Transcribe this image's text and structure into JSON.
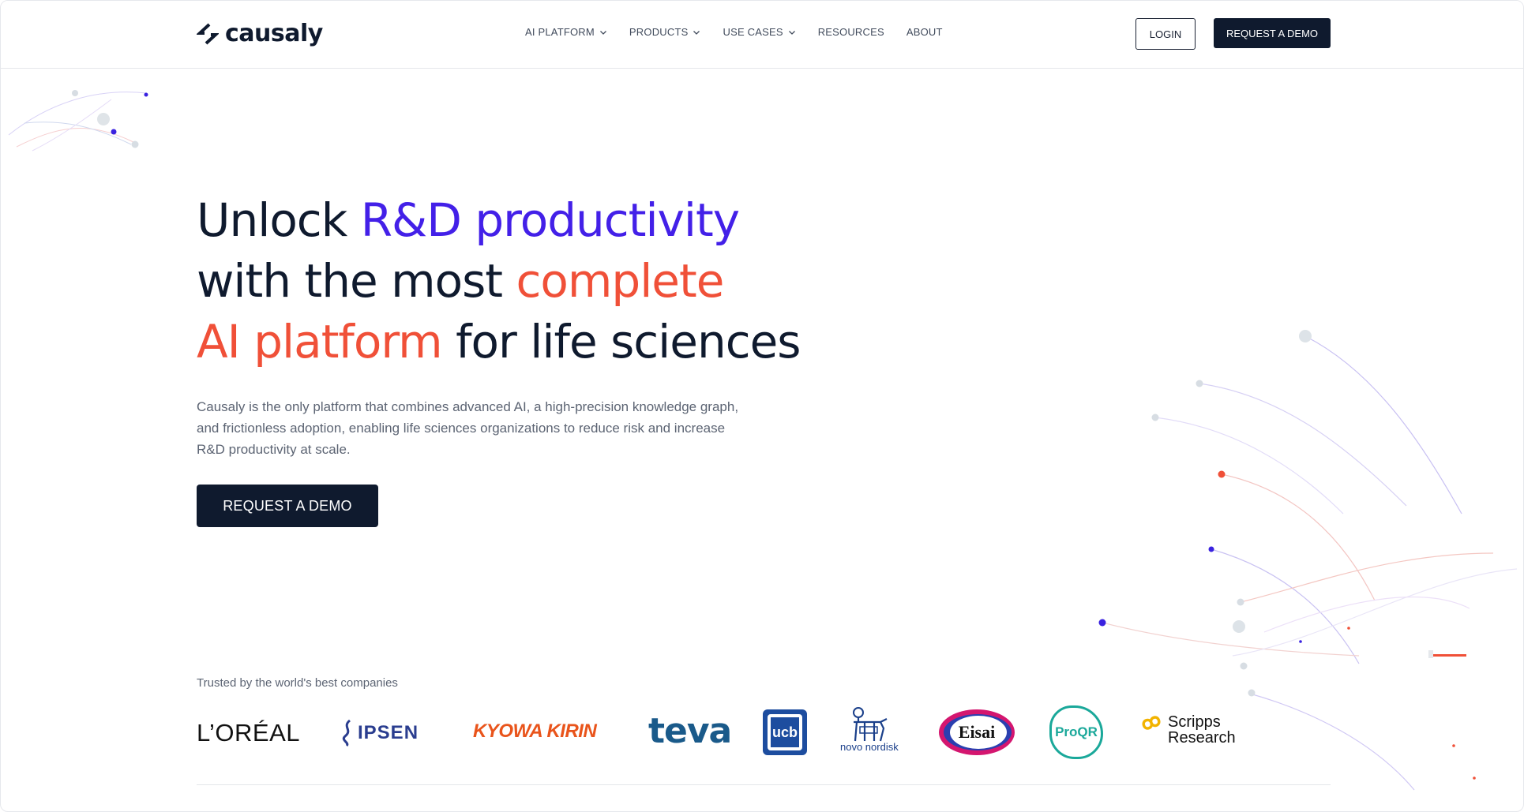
{
  "brand": {
    "name": "causaly"
  },
  "nav": {
    "items": [
      {
        "label": "AI PLATFORM",
        "has_dropdown": true
      },
      {
        "label": "PRODUCTS",
        "has_dropdown": true
      },
      {
        "label": "USE CASES",
        "has_dropdown": true
      },
      {
        "label": "RESOURCES",
        "has_dropdown": false
      },
      {
        "label": "ABOUT",
        "has_dropdown": false
      }
    ],
    "login_label": "LOGIN",
    "demo_label": "REQUEST A DEMO"
  },
  "hero": {
    "title_line1_a": "Unlock ",
    "title_line1_b": "R&D productivity",
    "title_line2_a": "with the most ",
    "title_line2_b": "complete",
    "title_line3_a": "AI platform",
    "title_line3_b": " for life sciences",
    "description": "Causaly is the only platform that combines advanced AI, a high-precision knowledge graph, and frictionless adoption, enabling life sciences organizations to reduce risk and increase R&D productivity at scale.",
    "cta_label": "REQUEST A DEMO"
  },
  "trusted": {
    "label": "Trusted by the world's best companies",
    "logos": {
      "loreal": "L’ORÉAL",
      "ipsen": "IPSEN",
      "kyowa": "KYOWA KIRIN",
      "teva": "teva",
      "ucb": "ucb",
      "novo": "novo nordisk",
      "eisai": "Eisai",
      "proqr": "ProQR",
      "scripps_1": "Scripps",
      "scripps_2": "Research"
    }
  },
  "colors": {
    "navy": "#0f1a2e",
    "accent_blue": "#4320e8",
    "accent_red": "#f05038"
  }
}
